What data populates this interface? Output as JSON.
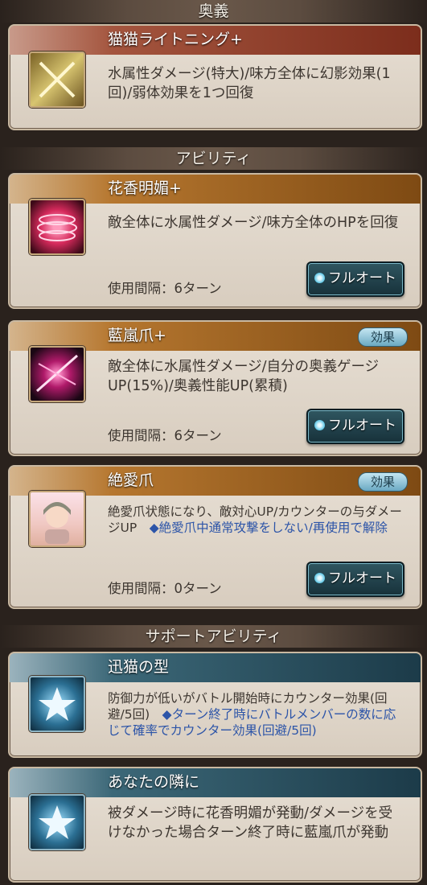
{
  "sections": {
    "ougi": "奥義",
    "ability": "アビリティ",
    "support": "サポートアビリティ"
  },
  "ougi": {
    "title": "猫猫ライトニング+",
    "desc": "水属性ダメージ(特大)/味方全体に幻影効果(1回)/弱体効果を1つ回復"
  },
  "abilities": [
    {
      "title": "花香明媚+",
      "desc": "敵全体に水属性ダメージ/味方全体のHPを回復",
      "cooldown": "使用間隔：6ターン",
      "button": "フルオート"
    },
    {
      "title": "藍嵐爪+",
      "badge": "効果",
      "desc": "敵全体に水属性ダメージ/自分の奥義ゲージUP(15%)/奥義性能UP(累積)",
      "cooldown": "使用間隔：6ターン",
      "button": "フルオート"
    },
    {
      "title": "絶愛爪",
      "badge": "効果",
      "desc": "絶愛爪状態になり、敵対心UP/カウンターの与ダメージUP",
      "note": "◆絶愛爪中通常攻撃をしない/再使用で解除",
      "cooldown": "使用間隔：0ターン",
      "button": "フルオート"
    }
  ],
  "supports": [
    {
      "title": "迅猫の型",
      "desc": "防御力が低いがバトル開始時にカウンター効果(回避/5回)",
      "note": "◆ターン終了時にバトルメンバーの数に応じて確率でカウンター効果(回避/5回)"
    },
    {
      "title": "あなたの隣に",
      "desc": "被ダメージ時に花香明媚が発動/ダメージを受けなかった場合ターン終了時に藍嵐爪が発動"
    }
  ],
  "icons": [
    "crossed-swords-icon",
    "pink-ring-icon",
    "pink-slash-icon",
    "character-portrait-icon",
    "star-icon",
    "star-icon"
  ],
  "colors": {
    "ougi_bar": "#7c2d1c",
    "ability_bar": "#7e4a13",
    "support_bar": "#1c3b49",
    "note": "#2c54a8"
  }
}
